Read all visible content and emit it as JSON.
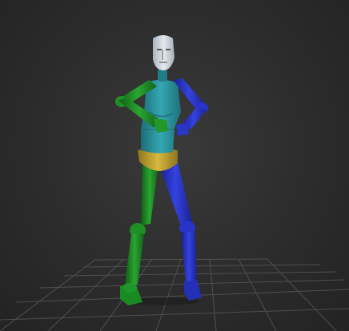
{
  "viewport": {
    "background": "#2c2c2c",
    "grid_color": "#5a5a5a",
    "grid_visible": true
  },
  "character": {
    "head_color": "#cfd5dc",
    "torso_color": "#2f9aa6",
    "pelvis_color": "#c8a834",
    "left_limb_color": "#1e8f25",
    "right_limb_color": "#2834c8"
  }
}
